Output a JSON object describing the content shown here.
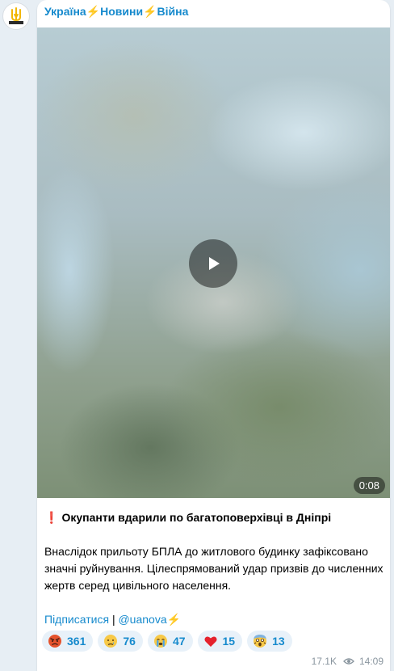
{
  "channel": {
    "name_part1": "Україна",
    "name_part2": "Новини",
    "name_part3": "Війна",
    "separator": "⚡",
    "avatar_icon": "trident-logo-icon"
  },
  "media": {
    "type": "video",
    "duration": "0:08",
    "play_icon": "play-icon"
  },
  "post": {
    "headline_mark": "❗",
    "headline": "Окупанти вдарили по багатоповерхівці в Дніпрі",
    "body": "Внаслідок прильоту БПЛА до житлового будинку зафіксовано значні руйнування. Цілеспрямований удар призвів до численних жертв серед цивільного населення.",
    "subscribe_link": "Підписатися",
    "link_separator": "|",
    "handle_link": "@uanova",
    "handle_suffix": "⚡"
  },
  "reactions": [
    {
      "icon": "angry-face-icon",
      "count": "361"
    },
    {
      "icon": "crying-face-icon",
      "count": "76"
    },
    {
      "icon": "sobbing-face-icon",
      "count": "47"
    },
    {
      "icon": "heart-icon",
      "count": "15"
    },
    {
      "icon": "screaming-face-icon",
      "count": "13"
    }
  ],
  "meta": {
    "views": "17.1K",
    "time": "14:09",
    "views_icon": "eye-icon"
  },
  "colors": {
    "accent": "#168acd",
    "bolt": "#f5b000",
    "background": "#e7eef4"
  }
}
